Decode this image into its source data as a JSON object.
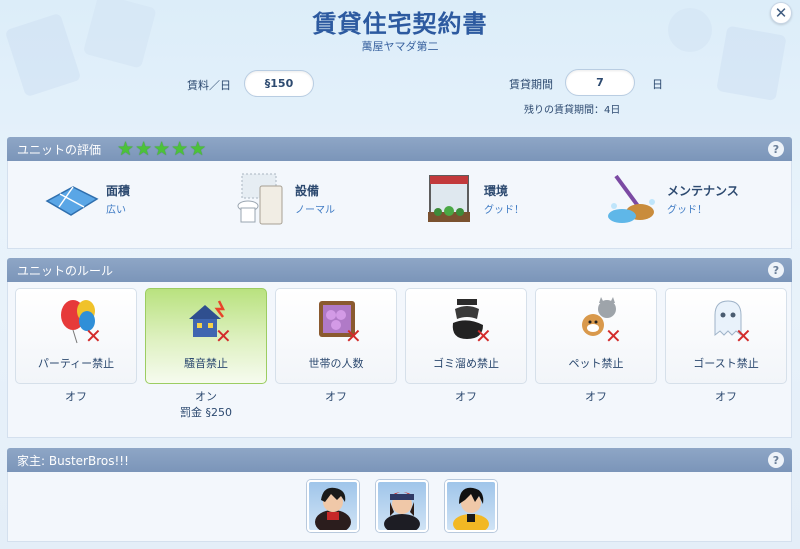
{
  "header": {
    "title": "賃貸住宅契約書",
    "subtitle": "萬屋ヤマダ第二",
    "rent_label": "賃料／日",
    "rent_value": "§150",
    "period_label": "賃貸期間",
    "period_value": "7",
    "period_unit": "日",
    "remaining": "残りの賃貸期間：4日"
  },
  "evaluation": {
    "title": "ユニットの評価",
    "stars": 5,
    "items": [
      {
        "name": "面積",
        "value": "広い",
        "icon": "floor-plan-icon"
      },
      {
        "name": "設備",
        "value": "ノーマル",
        "icon": "appliances-icon"
      },
      {
        "name": "環境",
        "value": "グッド！",
        "icon": "window-plants-icon"
      },
      {
        "name": "メンテナンス",
        "value": "グッド！",
        "icon": "mop-bucket-icon"
      }
    ]
  },
  "rules": {
    "title": "ユニットのルール",
    "items": [
      {
        "label": "パーティー禁止",
        "status": "オフ",
        "icon": "balloons-icon",
        "active": false
      },
      {
        "label": "騒音禁止",
        "status": "オン",
        "fine": "罰金 §250",
        "icon": "noise-house-icon",
        "active": true
      },
      {
        "label": "世帯の人数",
        "status": "オフ",
        "icon": "crowd-icon",
        "active": false
      },
      {
        "label": "ゴミ溜め禁止",
        "status": "オフ",
        "icon": "trash-bag-icon",
        "active": false
      },
      {
        "label": "ペット禁止",
        "status": "オフ",
        "icon": "pets-icon",
        "active": false
      },
      {
        "label": "ゴースト禁止",
        "status": "オフ",
        "icon": "ghost-icon",
        "active": false
      }
    ]
  },
  "landlord": {
    "title": "家主: BusterBros!!!",
    "avatars": [
      "sim-avatar-1",
      "sim-avatar-2",
      "sim-avatar-3"
    ]
  },
  "help_label": "?",
  "close_label": "✕",
  "colors": {
    "accent": "#2d5aa0",
    "section_bar": "#7f99bc",
    "active_card": "#b9e27f",
    "forbid_x": "#d32b2b"
  }
}
